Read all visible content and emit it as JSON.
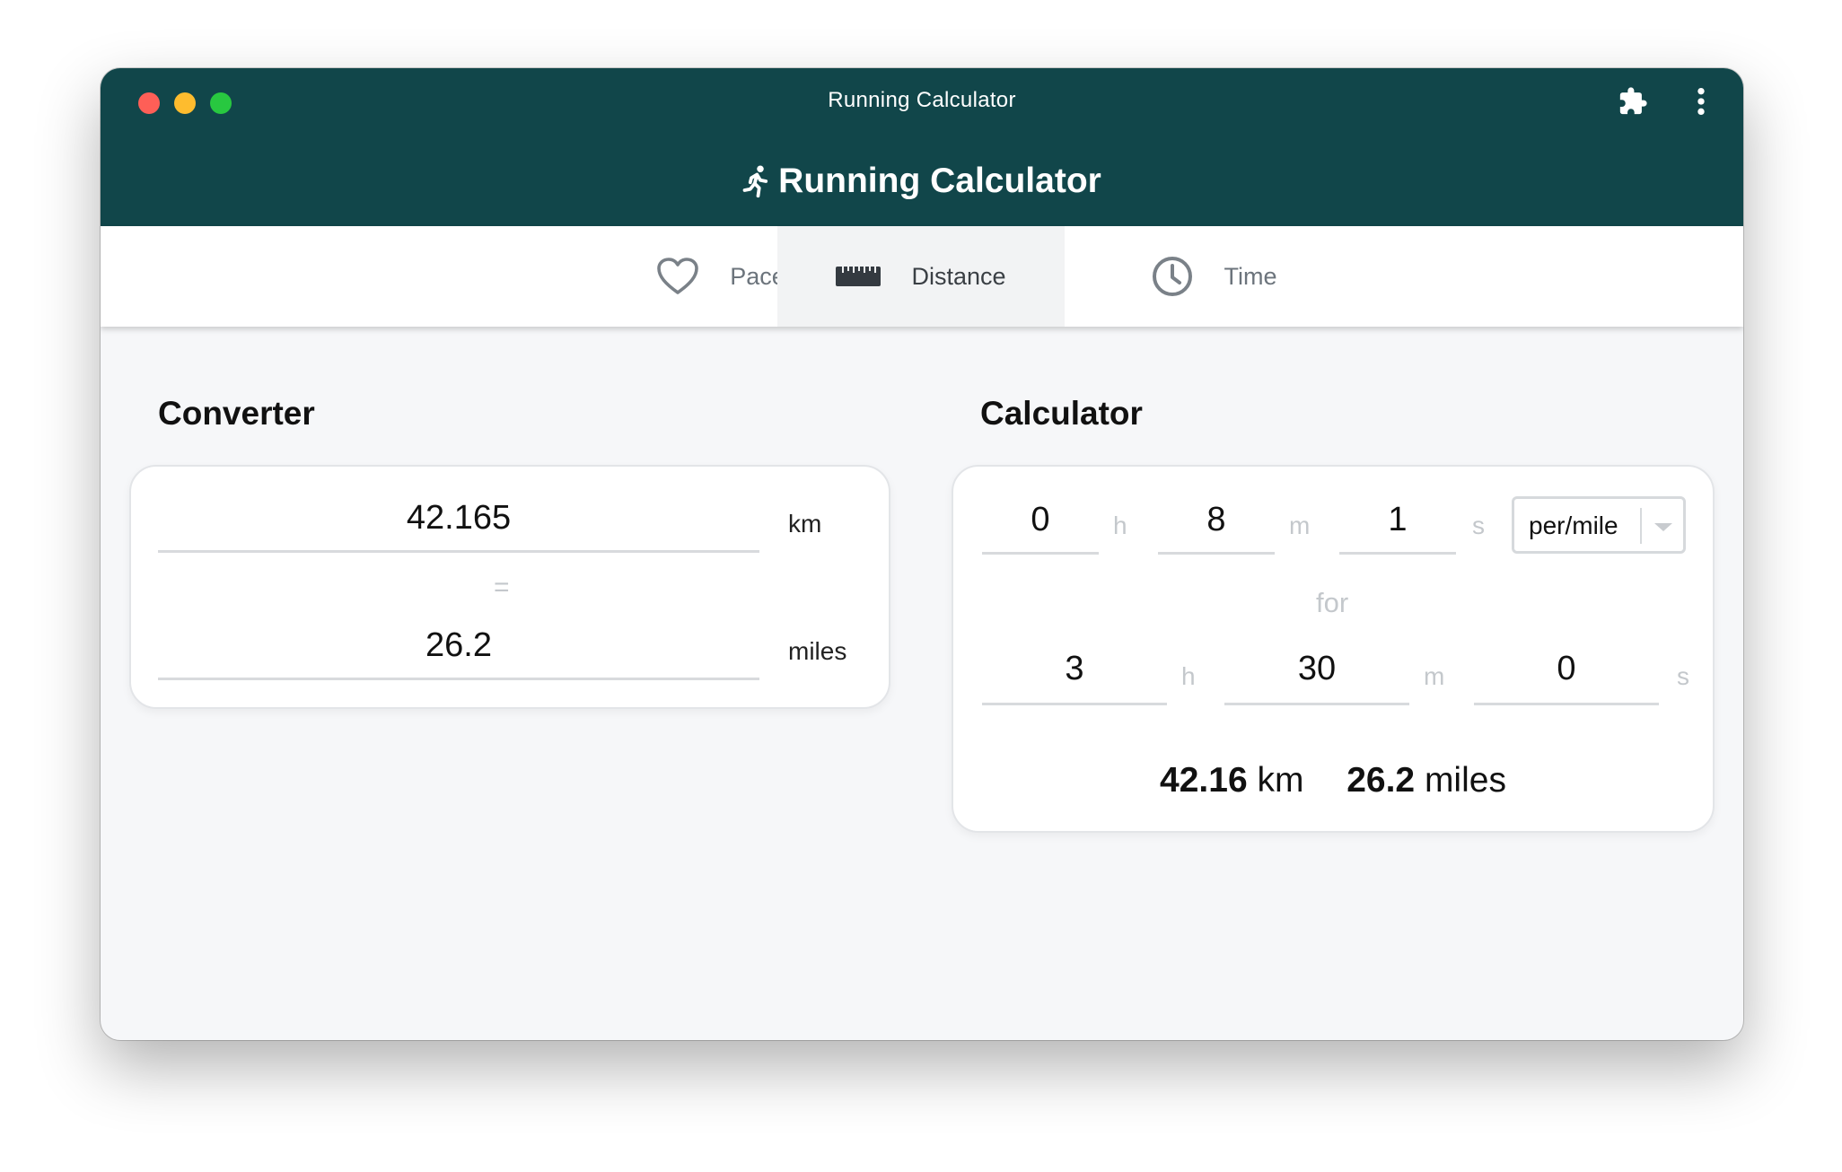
{
  "window": {
    "title": "Running Calculator"
  },
  "icons": {
    "extension": "puzzle-piece-icon",
    "menu": "vertical-ellipsis-icon",
    "runner": "running-person-icon"
  },
  "colors": {
    "header_bg": "#11464a",
    "active_tab_bg": "#f2f3f4",
    "page_bg": "#f6f7f9"
  },
  "app": {
    "title": "Running Calculator"
  },
  "tabs": [
    {
      "label": "Pace",
      "icon": "heart-icon",
      "active": false
    },
    {
      "label": "Distance",
      "icon": "ruler-icon",
      "active": true
    },
    {
      "label": "Time",
      "icon": "clock-icon",
      "active": false
    }
  ],
  "converter": {
    "title": "Converter",
    "km_value": "42.165",
    "km_unit": "km",
    "equals": "=",
    "miles_value": "26.2",
    "miles_unit": "miles"
  },
  "calculator": {
    "title": "Calculator",
    "pace": {
      "h": "0",
      "m": "8",
      "s": "1",
      "h_unit": "h",
      "m_unit": "m",
      "s_unit": "s"
    },
    "pace_unit": "per/mile",
    "for_label": "for",
    "duration": {
      "h": "3",
      "m": "30",
      "s": "0",
      "h_unit": "h",
      "m_unit": "m",
      "s_unit": "s"
    },
    "result_km_value": "42.16",
    "result_km_unit": "km",
    "result_miles_value": "26.2",
    "result_miles_unit": "miles"
  }
}
